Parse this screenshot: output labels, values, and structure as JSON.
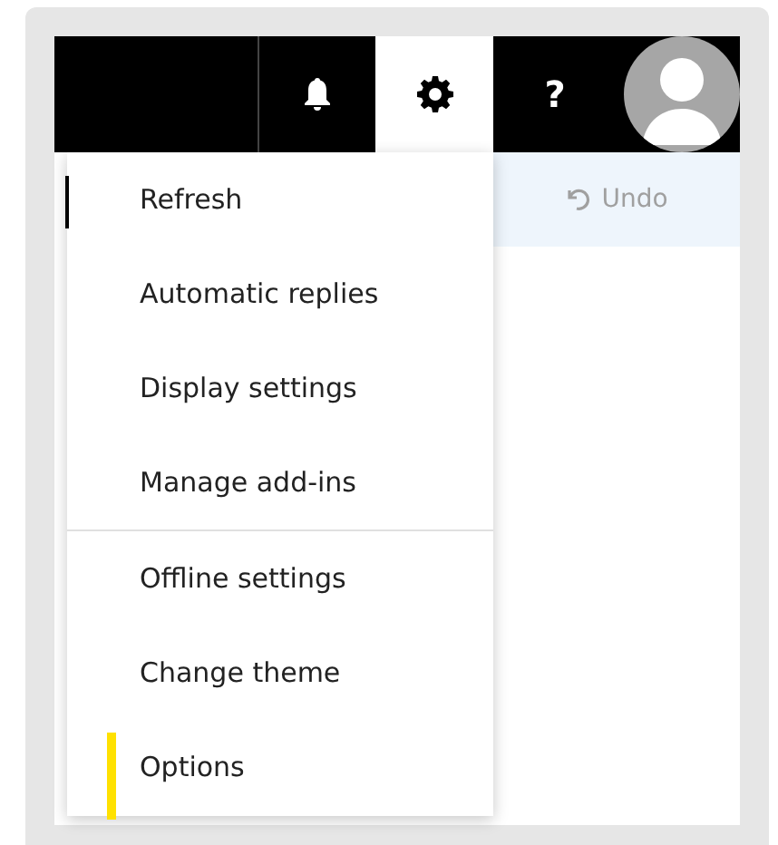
{
  "top_bar": {
    "buttons": [
      {
        "kind": "bell",
        "selected": false
      },
      {
        "kind": "gear",
        "selected": true
      },
      {
        "kind": "help",
        "label": "?",
        "selected": false
      },
      {
        "kind": "avatar",
        "selected": false
      }
    ]
  },
  "command_bar": {
    "undo": "Undo"
  },
  "settings_menu": {
    "groups": [
      [
        {
          "label": "Refresh",
          "selected": false
        },
        {
          "label": "Automatic replies",
          "selected": false
        },
        {
          "label": "Display settings",
          "selected": false
        },
        {
          "label": "Manage add-ins",
          "selected": false
        }
      ],
      [
        {
          "label": "Offline settings",
          "selected": false
        },
        {
          "label": "Change theme",
          "selected": false
        },
        {
          "label": "Options",
          "selected": true
        }
      ]
    ]
  }
}
